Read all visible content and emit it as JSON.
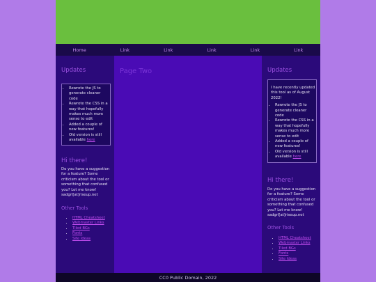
{
  "nav": [
    "Home",
    "Link",
    "Link",
    "Link",
    "Link",
    "Link"
  ],
  "left": {
    "updates_title": "Updates",
    "updates": [
      "Rewrote the JS to generate cleaner code",
      "Rewrote the CSS in a way that hopefully makes much more sense to edit",
      "Added a couple of new features!",
      "Old version is still available"
    ],
    "here_link": "here",
    "hi_title": "Hi there!",
    "hi_text": "Do you have a suggestion for a feature? Some criticism about the tool or something that confused you? Let me know! sadgrl[at]riseup.net",
    "other_title": "Other Tools",
    "other_links": [
      "HTML Cheatsheet",
      "Webmaster Links",
      "Tiled BGs",
      "Fonts",
      "Site Ideas"
    ]
  },
  "main": {
    "title": "Page Two"
  },
  "right": {
    "updates_title": "Updates",
    "intro": "I have recently updated this tool as of August 2022!",
    "updates": [
      "Rewrote the JS to generate cleaner code",
      "Rewrote the CSS in a way that hopefully makes much more sense to edit",
      "Added a couple of new features!",
      "Old version is still available"
    ],
    "here_link": "here",
    "hi_title": "Hi there!",
    "hi_text": "Do you have a suggestion for a feature? Some criticism about the tool or something that confused you? Let me know! sadgrl[at]riseup.net",
    "other_title": "Other Tools",
    "other_links": [
      "HTML Cheatsheet",
      "Webmaster Links",
      "Tiled BGs",
      "Fonts",
      "Site Ideas"
    ]
  },
  "footer": {
    "text": "CC0 Public Domain, 2022"
  },
  "colors": {
    "page_bg": "#b07be8",
    "header": "#6abf3e",
    "nav_bg": "#1a0a4a",
    "sidebar_bg": "#2b0a7a",
    "main_bg": "#4a0bb5",
    "accent": "#9b50e0",
    "link": "#c34df0"
  }
}
